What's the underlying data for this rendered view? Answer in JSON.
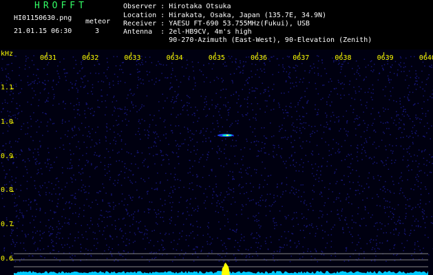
{
  "header": {
    "app_title": "HROFFT",
    "filename": "HI01150630.png",
    "meteor_label": "meteor",
    "datetime": "21.01.15 06:30",
    "meteor_count": "3"
  },
  "station": {
    "observer": "Observer : Hirotaka Otsuka",
    "location": "Location : Hirakata, Osaka, Japan (135.7E, 34.9N)",
    "receiver": "Receiver : YAESU FT-690 53.755MHz(Fukui), USB",
    "antenna": "Antenna  : 2el-HB9CV, 4m's high",
    "antenna_detail": "           90-270-Azimuth (East-West), 90-Elevation (Zenith)"
  },
  "spectrogram": {
    "unit_label": "kHz",
    "time_ticks": [
      "0631",
      "0632",
      "0633",
      "0634",
      "0635",
      "0636",
      "0637",
      "0638",
      "0639",
      "0640"
    ],
    "freq_ticks": [
      "1.1",
      "1.0",
      "0.9",
      "0.8",
      "0.7",
      "0.6"
    ],
    "colors": {
      "background": "#000010",
      "noise": "#1a1a8c",
      "echo": "#00ffcc",
      "baseline": "#00ccff",
      "carrier": "#ffff00",
      "labels": "#ffff00"
    }
  }
}
